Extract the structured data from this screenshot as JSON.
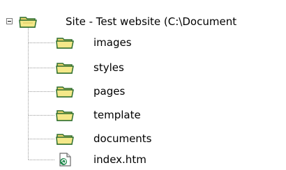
{
  "tree": {
    "root": {
      "label": "Site - Test website (C:\\Document",
      "icon": "folder-open-icon"
    },
    "items": [
      {
        "label": "images",
        "icon": "folder-icon"
      },
      {
        "label": "styles",
        "icon": "folder-icon"
      },
      {
        "label": "pages",
        "icon": "folder-icon"
      },
      {
        "label": "template",
        "icon": "folder-icon"
      },
      {
        "label": "documents",
        "icon": "folder-icon"
      },
      {
        "label": "index.htm",
        "icon": "html-file-icon"
      }
    ]
  }
}
